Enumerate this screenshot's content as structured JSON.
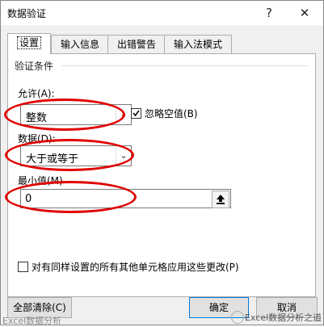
{
  "window": {
    "title": "数据验证",
    "help_icon": "?",
    "close_icon": "✕"
  },
  "tabs": [
    {
      "label": "设置"
    },
    {
      "label": "输入信息"
    },
    {
      "label": "出错警告"
    },
    {
      "label": "输入法模式"
    }
  ],
  "settings": {
    "group_label": "验证条件",
    "allow_label": "允许(A):",
    "allow_value": "整数",
    "ignore_blank_label": "忽略空值(B)",
    "ignore_blank_checked": true,
    "data_label": "数据(D):",
    "data_value": "大于或等于",
    "min_label": "最小值(M)",
    "min_value": "0",
    "apply_all_label": "对有同样设置的所有其他单元格应用这些更改(P)",
    "apply_all_checked": false
  },
  "buttons": {
    "clear_all": "全部清除(C)",
    "ok": "确定",
    "cancel": "取消"
  },
  "icons": {
    "dropdown": "chevron-down-icon",
    "collapse": "range-select-icon"
  },
  "colors": {
    "annotation_red": "#e00000",
    "accent": "#0078d7"
  },
  "watermark": {
    "left_text": "Excel数据分析",
    "right_text": "Excel数据分析之道"
  }
}
